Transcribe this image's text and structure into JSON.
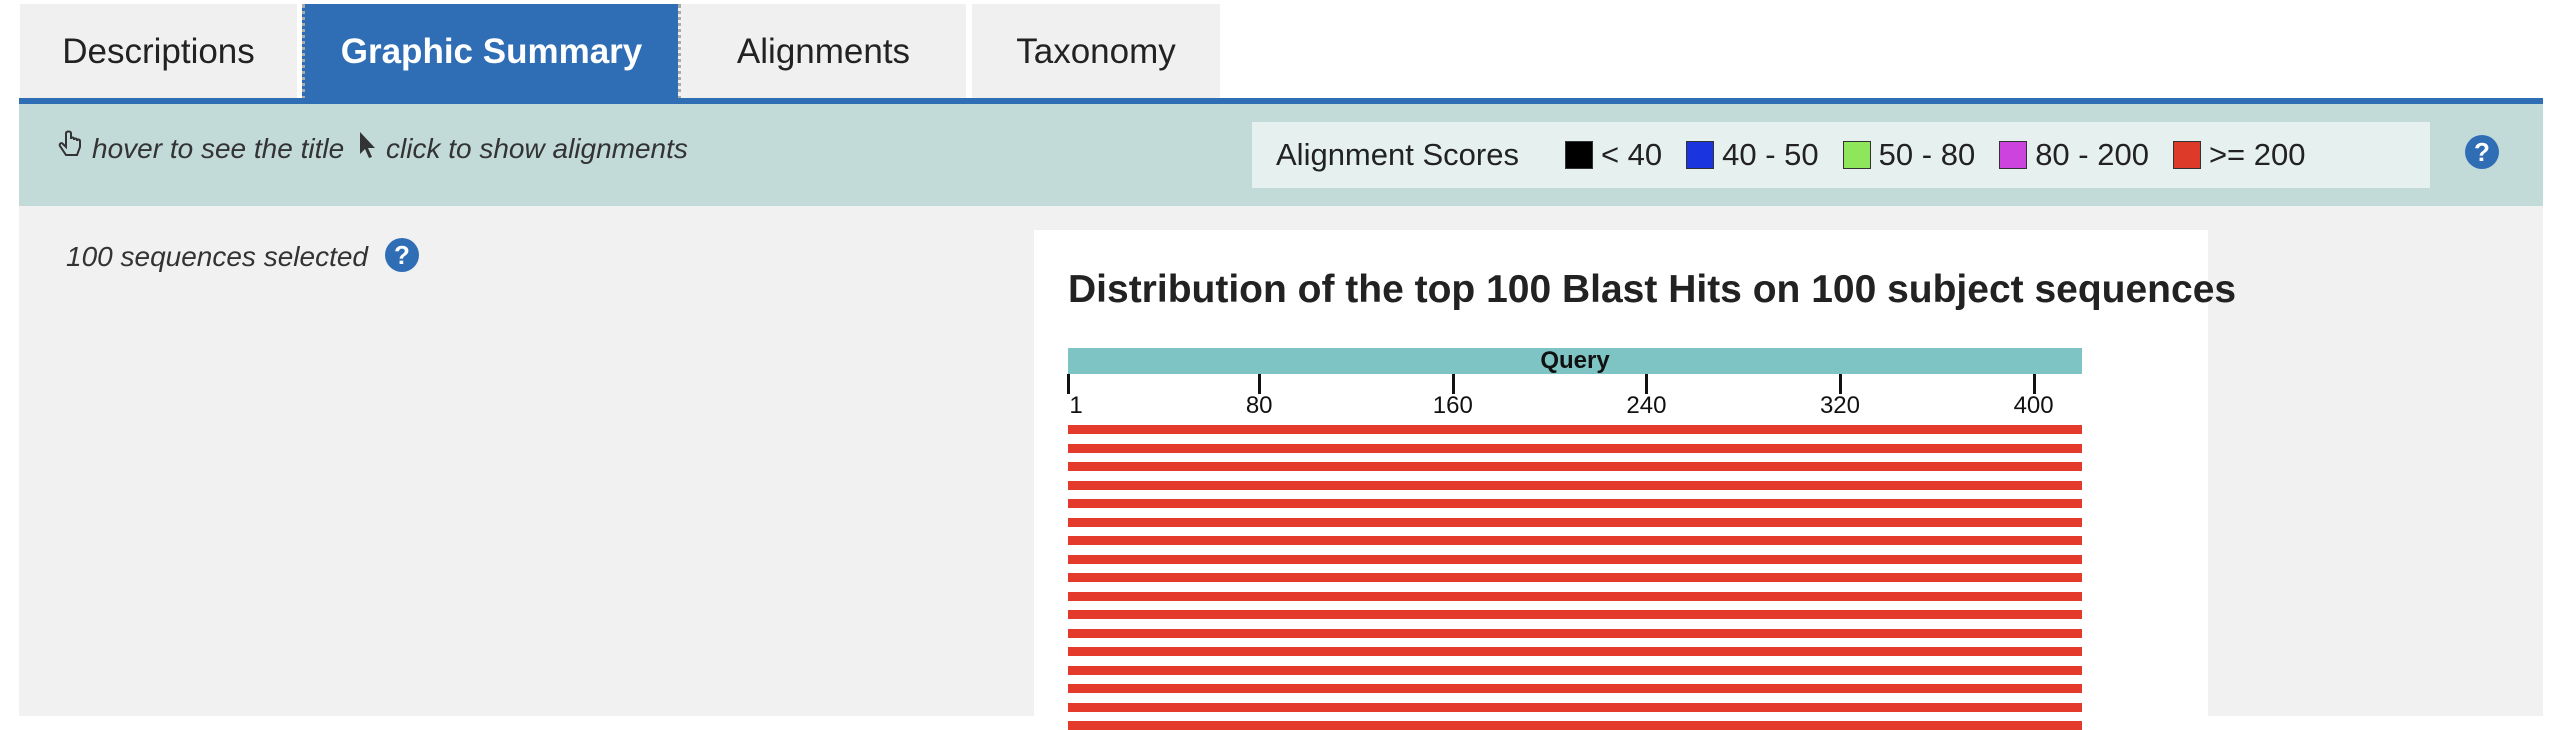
{
  "tabs": [
    {
      "label": "Descriptions",
      "active": false
    },
    {
      "label": "Graphic Summary",
      "active": true
    },
    {
      "label": "Alignments",
      "active": false
    },
    {
      "label": "Taxonomy",
      "active": false
    }
  ],
  "toolbar": {
    "hover_hint": "hover to see the title",
    "click_hint": "click to show alignments"
  },
  "legend": {
    "title": "Alignment Scores",
    "items": [
      {
        "label": "< 40",
        "color": "#000000"
      },
      {
        "label": "40 - 50",
        "color": "#1a35e0"
      },
      {
        "label": "50 - 80",
        "color": "#8ee65a"
      },
      {
        "label": "80 - 200",
        "color": "#cc44dd"
      },
      {
        "label": ">= 200",
        "color": "#dd3a2a"
      }
    ]
  },
  "selection": {
    "text": "100 sequences selected"
  },
  "chart": {
    "title": "Distribution of the top 100 Blast Hits on 100 subject sequences",
    "query_label": "Query",
    "ticks": [
      "1",
      "80",
      "160",
      "240",
      "320",
      "400"
    ],
    "hit_color": "#e33a2c"
  },
  "chart_data": {
    "type": "bar",
    "xlim": [
      1,
      420
    ],
    "ticks": [
      1,
      80,
      160,
      240,
      320,
      400
    ],
    "visible_hits": [
      {
        "start": 1,
        "end": 420,
        "score_class": ">= 200"
      },
      {
        "start": 1,
        "end": 420,
        "score_class": ">= 200"
      },
      {
        "start": 1,
        "end": 420,
        "score_class": ">= 200"
      },
      {
        "start": 1,
        "end": 420,
        "score_class": ">= 200"
      },
      {
        "start": 1,
        "end": 420,
        "score_class": ">= 200"
      },
      {
        "start": 1,
        "end": 420,
        "score_class": ">= 200"
      },
      {
        "start": 1,
        "end": 420,
        "score_class": ">= 200"
      },
      {
        "start": 1,
        "end": 420,
        "score_class": ">= 200"
      },
      {
        "start": 1,
        "end": 420,
        "score_class": ">= 200"
      },
      {
        "start": 1,
        "end": 420,
        "score_class": ">= 200"
      },
      {
        "start": 1,
        "end": 420,
        "score_class": ">= 200"
      },
      {
        "start": 1,
        "end": 420,
        "score_class": ">= 200"
      },
      {
        "start": 1,
        "end": 420,
        "score_class": ">= 200"
      },
      {
        "start": 1,
        "end": 420,
        "score_class": ">= 200"
      },
      {
        "start": 1,
        "end": 420,
        "score_class": ">= 200"
      },
      {
        "start": 1,
        "end": 420,
        "score_class": ">= 200"
      },
      {
        "start": 1,
        "end": 420,
        "score_class": ">= 200"
      }
    ]
  }
}
